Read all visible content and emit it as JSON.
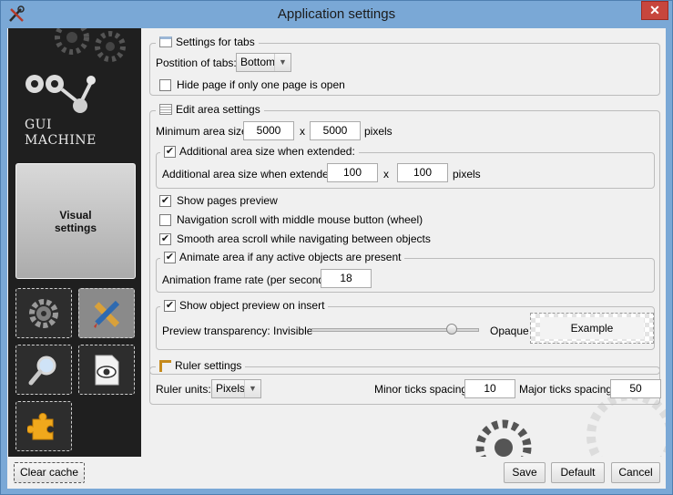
{
  "window": {
    "title": "Application settings",
    "close_glyph": "✕",
    "icon": "tools-icon"
  },
  "sidebar": {
    "logo_line1": "GUI",
    "logo_line2": "MACHINE",
    "selected_label_line1": "Visual",
    "selected_label_line2": "settings",
    "tiles": [
      {
        "name": "gear-icon"
      },
      {
        "name": "pencil-ruler-icon",
        "selected": true
      },
      {
        "name": "magnifier-icon"
      },
      {
        "name": "document-eye-icon"
      },
      {
        "name": "puzzle-icon"
      }
    ]
  },
  "tabs_group": {
    "title": "Settings for tabs",
    "position_label": "Postition of tabs:",
    "position_value": "Bottom",
    "hide_label": "Hide page if only one page is open",
    "hide_checked": false
  },
  "edit_group": {
    "title": "Edit area settings",
    "min_label": "Minimum area size:",
    "min_w": "5000",
    "min_x": "x",
    "min_h": "5000",
    "min_unit": "pixels",
    "ext_title": "Additional area size when extended:",
    "ext_checked": true,
    "ext_label": "Additional area size when extended:",
    "ext_w": "100",
    "ext_x": "x",
    "ext_h": "100",
    "ext_unit": "pixels",
    "show_preview": "Show pages preview",
    "show_preview_checked": true,
    "nav_scroll": "Navigation scroll with middle mouse button (wheel)",
    "nav_scroll_checked": false,
    "smooth_scroll": "Smooth area scroll while navigating between objects",
    "smooth_scroll_checked": true,
    "anim_title": "Animate area if any active objects are present",
    "anim_checked": true,
    "anim_label": "Animation frame rate (per second):",
    "anim_value": "18",
    "obj_title": "Show object preview on insert",
    "obj_checked": true,
    "transp_label": "Preview transparency: Invisible",
    "transp_level": 0.87,
    "opaque_label": "Opaque",
    "example_label": "Example"
  },
  "ruler_group": {
    "title": "Ruler settings",
    "units_label": "Ruler units:",
    "units_value": "Pixels",
    "minor_label": "Minor ticks spacing:",
    "minor_value": "10",
    "major_label": "Major ticks spacing:",
    "major_value": "50"
  },
  "footer": {
    "clear_cache": "Clear cache",
    "save": "Save",
    "default": "Default",
    "cancel": "Cancel"
  },
  "colors": {
    "title_bar": "#7aa8d6",
    "close_button": "#c7463d",
    "sidebar_bg": "#1f1f1f"
  }
}
